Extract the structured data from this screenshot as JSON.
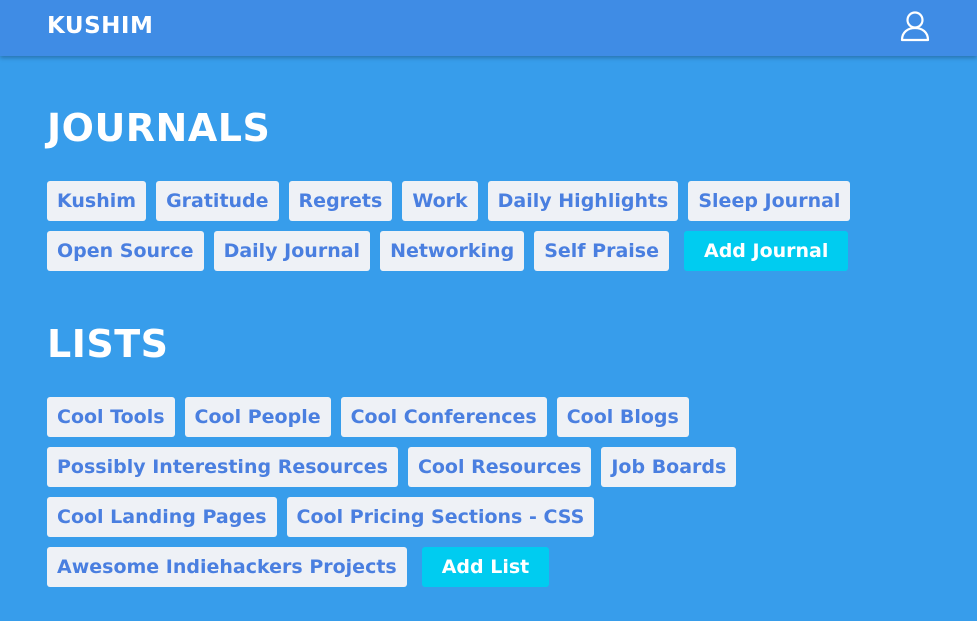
{
  "header": {
    "brand": "KUSHIM",
    "user_icon": "user-icon"
  },
  "journals": {
    "title": "JOURNALS",
    "items": [
      "Kushim",
      "Gratitude",
      "Regrets",
      "Work",
      "Daily Highlights",
      "Sleep Journal",
      "Open Source",
      "Daily Journal",
      "Networking",
      "Self Praise"
    ],
    "add_label": "Add Journal"
  },
  "lists": {
    "title": "LISTS",
    "items": [
      "Cool Tools",
      "Cool People",
      "Cool Conferences",
      "Cool Blogs",
      "Possibly Interesting Resources",
      "Cool Resources",
      "Job Boards",
      "Cool Landing Pages",
      "Cool Pricing Sections - CSS",
      "Awesome Indiehackers Projects"
    ],
    "add_label": "Add List"
  },
  "colors": {
    "background": "#379deb",
    "navbar": "#3f8ce5",
    "tag_bg": "#eef1f6",
    "tag_text": "#4a7fe0",
    "add_button": "#00ccf0"
  }
}
